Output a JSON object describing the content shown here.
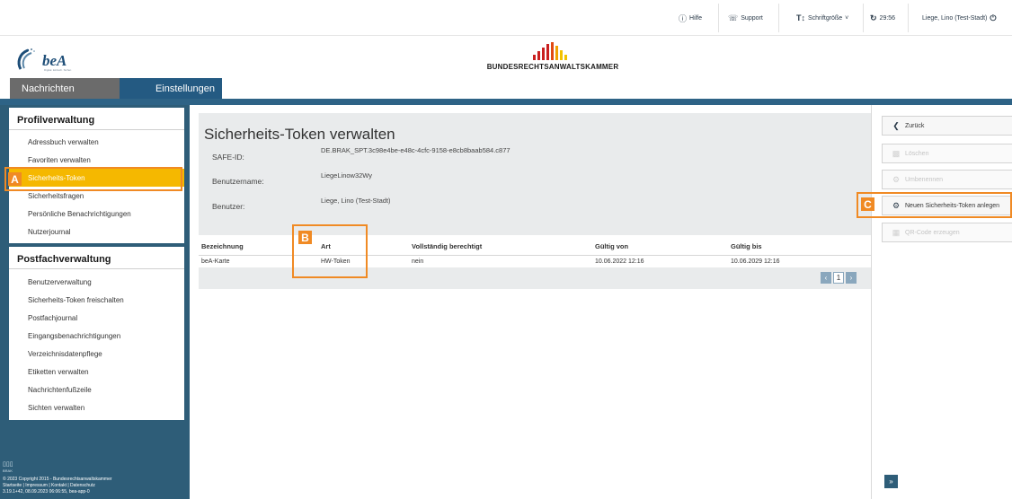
{
  "topbar": {
    "help": "Hilfe",
    "support": "Support",
    "font_size": "Schriftgröße",
    "timer": "29:56",
    "user": "Liege, Lino (Test-Stadt)"
  },
  "header": {
    "logo_text": "beA",
    "logo_sub": "Digital. Einfach. Sicher.",
    "org_name": "BUNDESRECHTSANWALTSKAMMER"
  },
  "tabs": [
    {
      "label": "Nachrichten"
    },
    {
      "label": "Einstellungen"
    }
  ],
  "sidebar": {
    "profile": {
      "title": "Profilverwaltung",
      "items": [
        "Adressbuch verwalten",
        "Favoriten verwalten",
        "Sicherheits-Token",
        "Sicherheitsfragen",
        "Persönliche Benachrichtigungen",
        "Nutzerjournal"
      ]
    },
    "mailbox": {
      "title": "Postfachverwaltung",
      "items": [
        "Benutzerverwaltung",
        "Sicherheits-Token freischalten",
        "Postfachjournal",
        "Eingangsbenachrichtigungen",
        "Verzeichnisdatenpflege",
        "Etiketten verwalten",
        "Nachrichtenfußzeile",
        "Sichten verwalten"
      ]
    },
    "footer": {
      "brand": "BRAK",
      "copyright": "© 2023 Copyright 2015 - Bundesrechtsanwaltskammer",
      "links": "Startseite | Impressum | Kontakt | Datenschutz",
      "version": "3.19.1+42, 08.09.2023 06:06:55, bea-app-0"
    }
  },
  "main": {
    "title": "Sicherheits-Token verwalten",
    "fields": {
      "safe_id_label": "SAFE-ID:",
      "safe_id_value": "DE.BRAK_SPT.3c98e4be-e48c-4cfc-9158-e8cb8baab584.c877",
      "username_label": "Benutzername:",
      "username_value": "LiegeLinow32Wy",
      "user_label": "Benutzer:",
      "user_value": "Liege, Lino (Test-Stadt)"
    },
    "table": {
      "headers": [
        "Bezeichnung",
        "Art",
        "Vollständig berechtigt",
        "Gültig von",
        "Gültig bis"
      ],
      "rows": [
        [
          "beA-Karte",
          "HW-Token",
          "nein",
          "10.06.2022 12:16",
          "10.06.2029 12:16"
        ]
      ],
      "page": "1"
    }
  },
  "actions": {
    "back": "Zurück",
    "delete": "Löschen",
    "rename": "Umbenennen",
    "new_token": "Neuen Sicherheits-Token anlegen",
    "qr": "QR-Code erzeugen"
  },
  "annotations": [
    "A",
    "B",
    "C"
  ],
  "colors": {
    "accent": "#2e5d78",
    "highlight": "#f5b800",
    "annotation": "#f08a24"
  }
}
